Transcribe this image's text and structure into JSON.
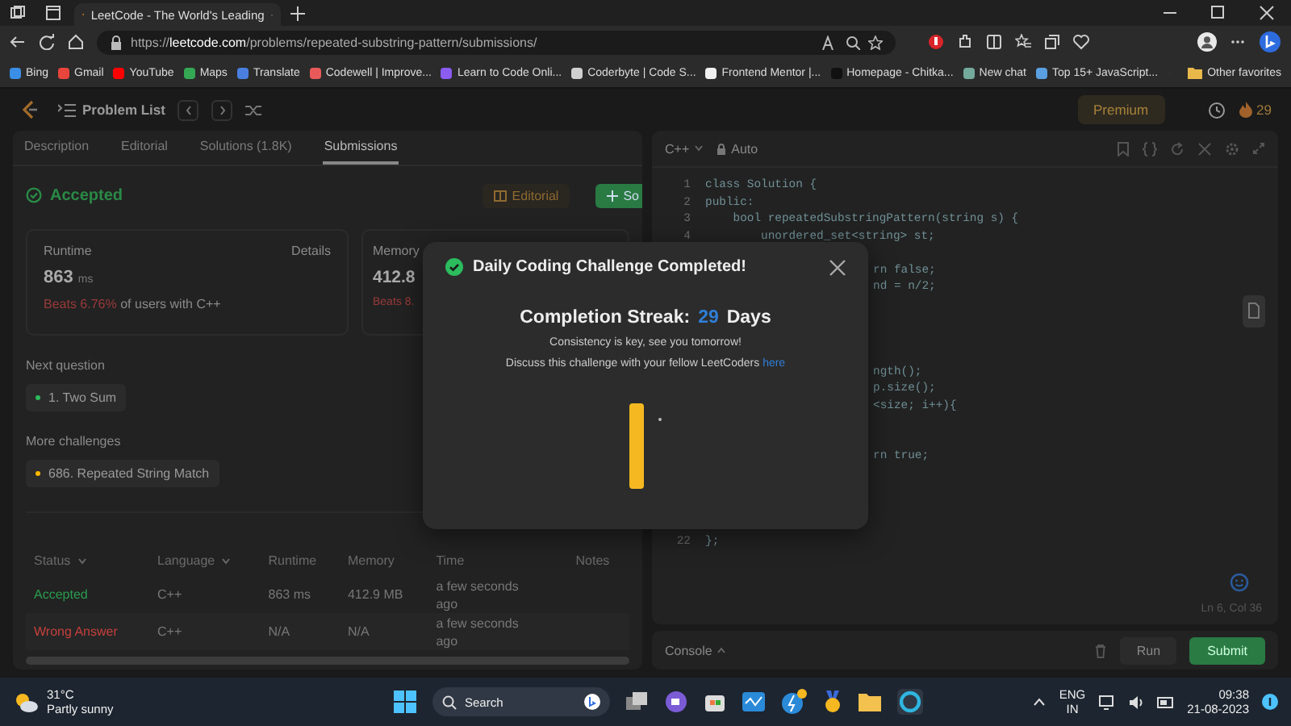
{
  "browser": {
    "tab_title": "LeetCode - The World's Leading",
    "url": "https://**leetcode.com**/problems/repeated-substring-pattern/submissions/",
    "bookmarks": [
      {
        "label": "Bing",
        "color": "#3a8ee6"
      },
      {
        "label": "Gmail",
        "color": "#e8453c"
      },
      {
        "label": "YouTube",
        "color": "#ff0000"
      },
      {
        "label": "Maps",
        "color": "#34a853"
      },
      {
        "label": "Translate",
        "color": "#4a7fe0"
      },
      {
        "label": "Codewell | Improve...",
        "color": "#e85a5a"
      },
      {
        "label": "Learn to Code Onli...",
        "color": "#8a5cf0"
      },
      {
        "label": "Coderbyte | Code S...",
        "color": "#d0d0d0"
      },
      {
        "label": "Frontend Mentor |...",
        "color": "#f0f0f0"
      },
      {
        "label": "Homepage - Chitka...",
        "color": "#111111"
      },
      {
        "label": "New chat",
        "color": "#74aa9c"
      },
      {
        "label": "Top 15+ JavaScript...",
        "color": "#5aa0e0"
      }
    ],
    "other_favorites": "Other favorites"
  },
  "header": {
    "problem_list": "Problem List",
    "premium": "Premium",
    "streak": "29"
  },
  "tabs": [
    {
      "label": "Description",
      "selected": false
    },
    {
      "label": "Editorial",
      "selected": false
    },
    {
      "label": "Solutions (1.8K)",
      "selected": false
    },
    {
      "label": "Submissions",
      "selected": true
    }
  ],
  "result": {
    "status": "Accepted",
    "editorial": "Editorial",
    "solution": "So"
  },
  "runtime": {
    "label": "Runtime",
    "details": "Details",
    "value": "863",
    "unit": "ms",
    "beats": "Beats 6.76%",
    "beats_suffix": "of users with C++"
  },
  "memory": {
    "label": "Memory",
    "value": "412.8",
    "beats": "Beats 8."
  },
  "next_question": {
    "label": "Next question",
    "item": "1. Two Sum",
    "color": "#2cbb5d"
  },
  "more_challenges": {
    "label": "More challenges",
    "item": "686. Repeated String Match",
    "color": "#ffb800"
  },
  "submissions": {
    "columns": [
      {
        "label": "Status",
        "sortable": true
      },
      {
        "label": "Language",
        "sortable": true
      },
      {
        "label": "Runtime",
        "sortable": false
      },
      {
        "label": "Memory",
        "sortable": false
      },
      {
        "label": "Time",
        "sortable": false
      },
      {
        "label": "Notes",
        "sortable": false
      }
    ],
    "rows": [
      {
        "status": "Accepted",
        "kind": "accepted",
        "language": "C++",
        "runtime": "863 ms",
        "memory": "412.9 MB",
        "time": "a few seconds ago"
      },
      {
        "status": "Wrong Answer",
        "kind": "wrong",
        "language": "C++",
        "runtime": "N/A",
        "memory": "N/A",
        "time": "a few seconds ago"
      }
    ]
  },
  "editor": {
    "language": "C++",
    "mode": "Auto",
    "cursor": "Ln 6, Col 36",
    "lines": [
      {
        "kind": "full",
        "number": "1",
        "text": "class Solution {"
      },
      {
        "kind": "full",
        "number": "2",
        "text": "public:"
      },
      {
        "kind": "full",
        "number": "3",
        "text": "    bool repeatedSubstringPattern(string s) {"
      },
      {
        "kind": "full",
        "number": "4",
        "text": "        unordered_set<string> st;"
      },
      {
        "kind": "covered"
      },
      {
        "kind": "clipped",
        "text": "rn false;"
      },
      {
        "kind": "clipped",
        "text": "nd = n/2;"
      },
      {
        "kind": "covered"
      },
      {
        "kind": "covered"
      },
      {
        "kind": "covered"
      },
      {
        "kind": "covered"
      },
      {
        "kind": "clipped",
        "text": "ngth();"
      },
      {
        "kind": "clipped",
        "text": "p.size();"
      },
      {
        "kind": "clipped",
        "text": "<size; i++){"
      },
      {
        "kind": "covered"
      },
      {
        "kind": "covered"
      },
      {
        "kind": "clipped",
        "text": "rn true;"
      },
      {
        "kind": "covered"
      },
      {
        "kind": "covered"
      },
      {
        "kind": "covered"
      },
      {
        "kind": "covered"
      },
      {
        "kind": "full",
        "number": "22",
        "text": "};"
      }
    ]
  },
  "console": {
    "label": "Console",
    "run": "Run",
    "submit": "Submit"
  },
  "modal": {
    "title": "Daily Coding Challenge Completed!",
    "streak_label": "Completion Streak:",
    "streak_value": "29",
    "streak_unit": "Days",
    "message": "Consistency is key, see you tomorrow!",
    "discuss": "Discuss this challenge with your fellow LeetCoders",
    "link": "here"
  },
  "taskbar": {
    "temperature": "31°C",
    "weather": "Partly sunny",
    "search": "Search",
    "language": "ENG",
    "region": "IN",
    "time": "09:38",
    "date": "21-08-2023"
  }
}
